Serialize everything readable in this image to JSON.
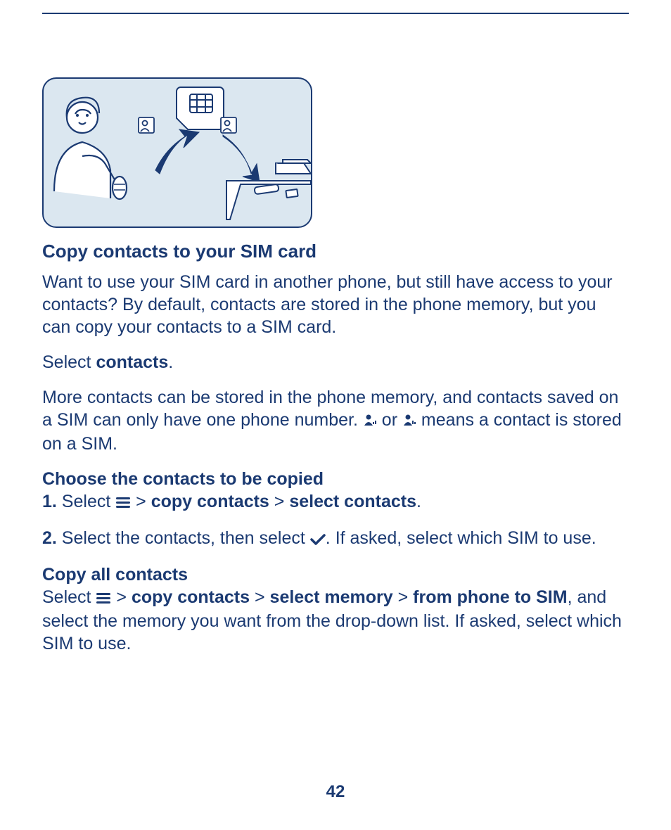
{
  "section": {
    "title": "Copy contacts to your SIM card",
    "intro": "Want to use your SIM card in another phone, but still have access to your contacts? By default, contacts are stored in the phone memory, but you can copy your contacts to a SIM card.",
    "select_prefix": "Select ",
    "select_label": "contacts",
    "select_suffix": ".",
    "sim_note_part1": "More contacts can be stored in the phone memory, and contacts saved on a SIM can only have one phone number. ",
    "sim_note_or": " or ",
    "sim_note_part2": " means a contact is stored on a SIM."
  },
  "choose": {
    "heading": "Choose the contacts to be copied",
    "step1_num": "1.",
    "step1_select": " Select ",
    "step1_sep1": " > ",
    "step1_copy": "copy contacts",
    "step1_sep2": " > ",
    "step1_selcontacts": "select contacts",
    "step1_end": ".",
    "step2_num": "2.",
    "step2_a": " Select the contacts, then select ",
    "step2_b": ". If asked, select which SIM to use."
  },
  "copyall": {
    "heading": "Copy all contacts",
    "a": "Select ",
    "sep1": " > ",
    "copy": "copy contacts",
    "sep2": " > ",
    "selmem": "select memory",
    "sep3": " > ",
    "phone2sim": "from phone to SIM",
    "tail": ", and select the memory you want from the drop-down list. If asked, select which SIM to use."
  },
  "page_number": "42",
  "icons": {
    "menu": "menu-icon",
    "check": "check-icon",
    "contact1": "contact-sim1-icon",
    "contact2": "contact-sim2-icon"
  }
}
